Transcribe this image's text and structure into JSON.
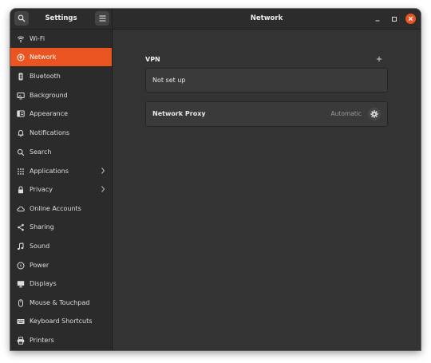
{
  "window": {
    "sidebar_title": "Settings",
    "main_title": "Network"
  },
  "sidebar": {
    "items": [
      {
        "label": "Wi-Fi",
        "icon": "wifi-icon"
      },
      {
        "label": "Network",
        "icon": "network-icon",
        "active": true
      },
      {
        "label": "Bluetooth",
        "icon": "bluetooth-icon"
      },
      {
        "label": "Background",
        "icon": "background-icon"
      },
      {
        "label": "Appearance",
        "icon": "appearance-icon"
      },
      {
        "label": "Notifications",
        "icon": "bell-icon"
      },
      {
        "label": "Search",
        "icon": "search-icon"
      },
      {
        "label": "Applications",
        "icon": "grid-icon",
        "submenu": true
      },
      {
        "label": "Privacy",
        "icon": "lock-icon",
        "submenu": true
      },
      {
        "label": "Online Accounts",
        "icon": "cloud-icon"
      },
      {
        "label": "Sharing",
        "icon": "share-icon"
      },
      {
        "label": "Sound",
        "icon": "music-note-icon"
      },
      {
        "label": "Power",
        "icon": "power-icon"
      },
      {
        "label": "Displays",
        "icon": "display-icon"
      },
      {
        "label": "Mouse & Touchpad",
        "icon": "mouse-icon"
      },
      {
        "label": "Keyboard Shortcuts",
        "icon": "keyboard-icon"
      },
      {
        "label": "Printers",
        "icon": "printer-icon"
      }
    ]
  },
  "main": {
    "vpn": {
      "title": "VPN",
      "status": "Not set up"
    },
    "proxy": {
      "label": "Network Proxy",
      "status": "Automatic"
    }
  },
  "colors": {
    "accent": "#e95420",
    "window_bg": "#333333",
    "sidebar_bg": "#2b2b2b"
  }
}
